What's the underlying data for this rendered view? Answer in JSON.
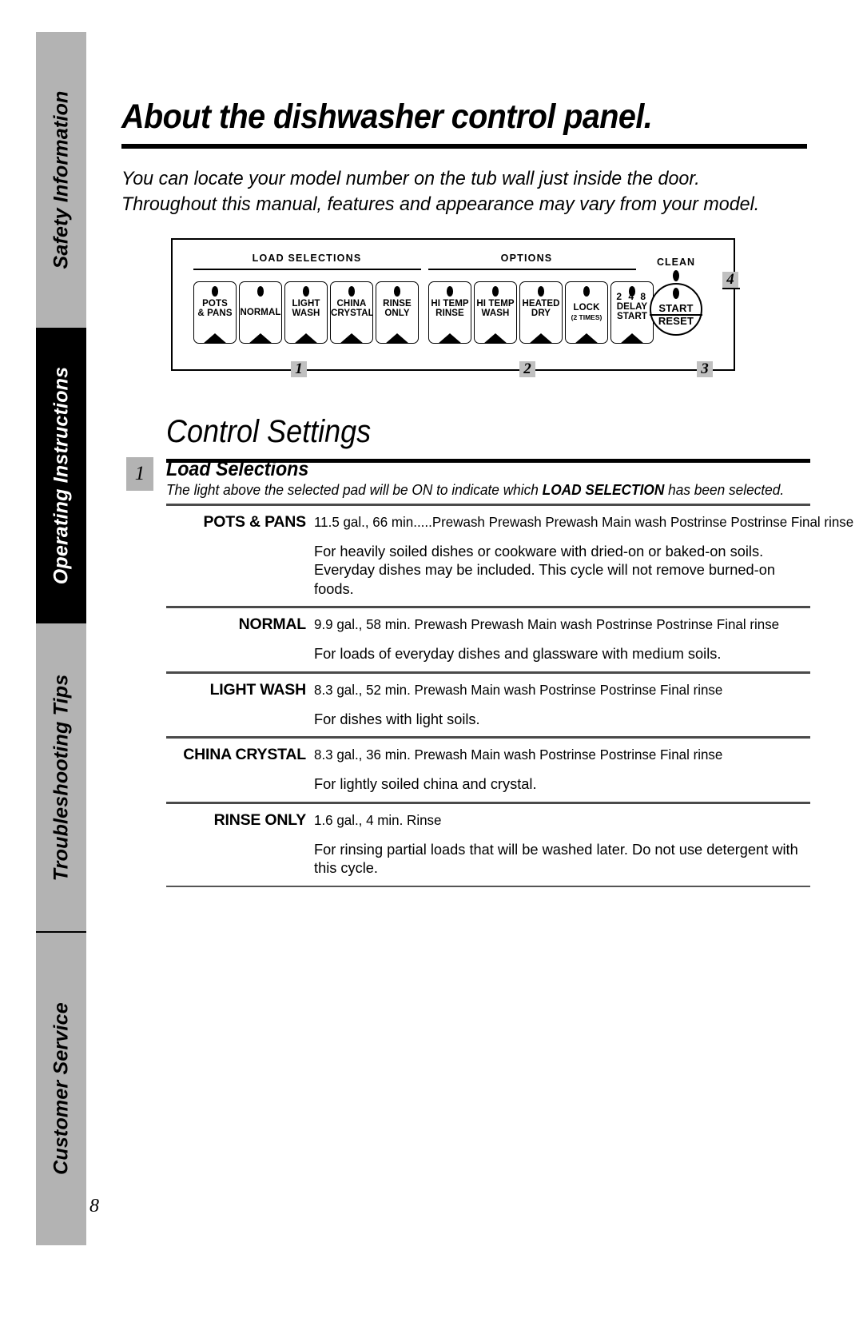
{
  "sidebar": {
    "tabs": [
      {
        "label": "Safety Information",
        "active": false
      },
      {
        "label": "Operating Instructions",
        "active": true
      },
      {
        "label": "Troubleshooting Tips",
        "active": false
      },
      {
        "label": "Customer Service",
        "active": false
      }
    ],
    "page_number": "8"
  },
  "header": {
    "title": "About the dishwasher control panel.",
    "intro_line1": "You can locate your model number on the tub wall just inside the door.",
    "intro_line2": "Throughout this manual, features and appearance may vary from your model."
  },
  "panel": {
    "section_load": "LOAD SELECTIONS",
    "section_options": "OPTIONS",
    "clean_label": "CLEAN",
    "start_top": "START",
    "start_bottom": "RESET",
    "load_pads": [
      {
        "line1": "POTS",
        "line2": "& PANS"
      },
      {
        "line1": "NORMAL",
        "line2": ""
      },
      {
        "line1": "LIGHT",
        "line2": "WASH"
      },
      {
        "line1": "CHINA",
        "line2": "CRYSTAL"
      },
      {
        "line1": "RINSE",
        "line2": "ONLY"
      }
    ],
    "option_pads": [
      {
        "line1": "HI TEMP",
        "line2": "RINSE",
        "small": "",
        "nums": ""
      },
      {
        "line1": "HI TEMP",
        "line2": "WASH",
        "small": "",
        "nums": ""
      },
      {
        "line1": "HEATED",
        "line2": "DRY",
        "small": "",
        "nums": ""
      },
      {
        "line1": "LOCK",
        "line2": "",
        "small": "(2 TIMES)",
        "nums": ""
      },
      {
        "line1": "DELAY",
        "line2": "START",
        "small": "",
        "nums": "2 4 8"
      }
    ],
    "callouts": [
      "1",
      "2",
      "3",
      "4"
    ]
  },
  "control_settings": {
    "heading": "Control Settings",
    "section_number": "1",
    "section_title": "Load Selections",
    "section_subtitle_part1": "The light above the selected pad will be ON to indicate which ",
    "section_subtitle_bold": "LOAD SELECTION",
    "section_subtitle_part2": " has been selected.",
    "cycles": [
      {
        "name": "POTS & PANS",
        "spec": "11.5 gal., 66 min.....Prewash Prewash Prewash Main wash Postrinse Postrinse Final rinse",
        "description": "For heavily soiled dishes or cookware with dried-on or baked-on soils. Everyday dishes may be included. This cycle will not remove burned-on foods."
      },
      {
        "name": "NORMAL",
        "spec": "9.9 gal., 58 min.    Prewash Prewash Main wash Postrinse Postrinse Final rinse",
        "description": "For loads of everyday dishes and glassware with medium soils."
      },
      {
        "name": "LIGHT WASH",
        "spec": "8.3 gal., 52 min.    Prewash Main wash Postrinse Postrinse Final rinse",
        "description": "For dishes with light soils."
      },
      {
        "name": "CHINA CRYSTAL",
        "spec": "8.3 gal., 36 min.    Prewash Main wash Postrinse Postrinse Final rinse",
        "description": "For lightly soiled china and crystal."
      },
      {
        "name": "RINSE ONLY",
        "spec": "1.6 gal.,  4 min.    Rinse",
        "description": "For rinsing partial loads that will be washed later. Do not use detergent with this cycle."
      }
    ]
  },
  "colors": {
    "tab_gray": "#b3b3b3",
    "tab_active": "#000000",
    "callout_gray": "#c0c0c0",
    "rule": "#4a4a4a"
  }
}
